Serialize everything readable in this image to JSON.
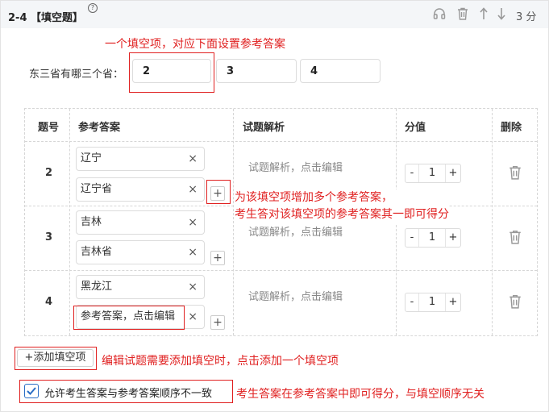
{
  "header": {
    "title": "2-4 【填空题】",
    "help_mark": "?",
    "score": "3 分",
    "icons": [
      "headphones-icon",
      "trash-icon",
      "arrow-up-icon",
      "arrow-down-icon"
    ]
  },
  "annotations": {
    "blank_note": "一个填空项，对应下面设置参考答案",
    "multi_answer_note_line1": "为该填空项增加多个参考答案，",
    "multi_answer_note_line2": "考生答对该填空项的参考答案其一即可得分",
    "add_blank_note": "编辑试题需要添加填空时，点击添加一个填空项",
    "order_note": "考生答案在参考答案中即可得分，与填空顺序无关"
  },
  "stem": {
    "question": "东三省有哪三个省：",
    "blanks": [
      "2",
      "3",
      "4"
    ]
  },
  "table": {
    "headers": [
      "题号",
      "参考答案",
      "试题解析",
      "分值",
      "删除"
    ],
    "rows": [
      {
        "num": "2",
        "answers": [
          "辽宁",
          "辽宁省"
        ],
        "explain": "试题解析，点击编辑",
        "score": "1"
      },
      {
        "num": "3",
        "answers": [
          "吉林",
          "吉林省"
        ],
        "explain": "试题解析，点击编辑",
        "score": "1"
      },
      {
        "num": "4",
        "answers": [
          "黑龙江",
          "参考答案，点击编辑"
        ],
        "explain": "试题解析，点击编辑",
        "score": "1"
      }
    ],
    "clear_symbol": "×",
    "plus_symbol": "+",
    "minus_symbol": "-"
  },
  "add_blank_button": "+添加填空项",
  "order_option": {
    "label": "允许考生答案与参考答案顺序不一致",
    "checked": true
  },
  "colors": {
    "accent": "#2b6ec5",
    "annotation": "#e02020",
    "header_bg": "#f4f6f8"
  }
}
